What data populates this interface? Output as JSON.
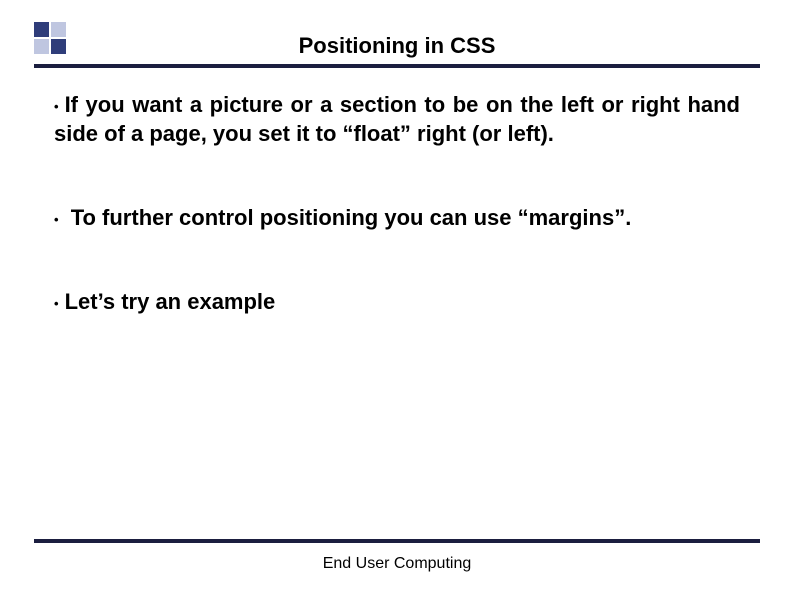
{
  "title": "Positioning in CSS",
  "bullets": [
    "If you want a picture or a section to be on the left or right hand side of a page, you set it to “float” right (or left).",
    "To further control positioning you can use “margins”.",
    "Let’s try an example"
  ],
  "footer": "End User Computing"
}
